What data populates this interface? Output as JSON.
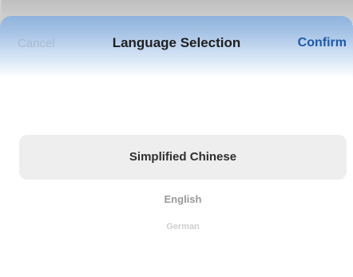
{
  "header": {
    "cancel_label": "Cancel",
    "title": "Language Selection",
    "confirm_label": "Confirm"
  },
  "picker": {
    "options": [
      "Simplified Chinese",
      "English",
      "German"
    ],
    "selected_index": 0
  },
  "colors": {
    "accent": "#1f59a8",
    "header_gradient_top": "#8fb3dc",
    "selection_background": "#eeeeee"
  }
}
